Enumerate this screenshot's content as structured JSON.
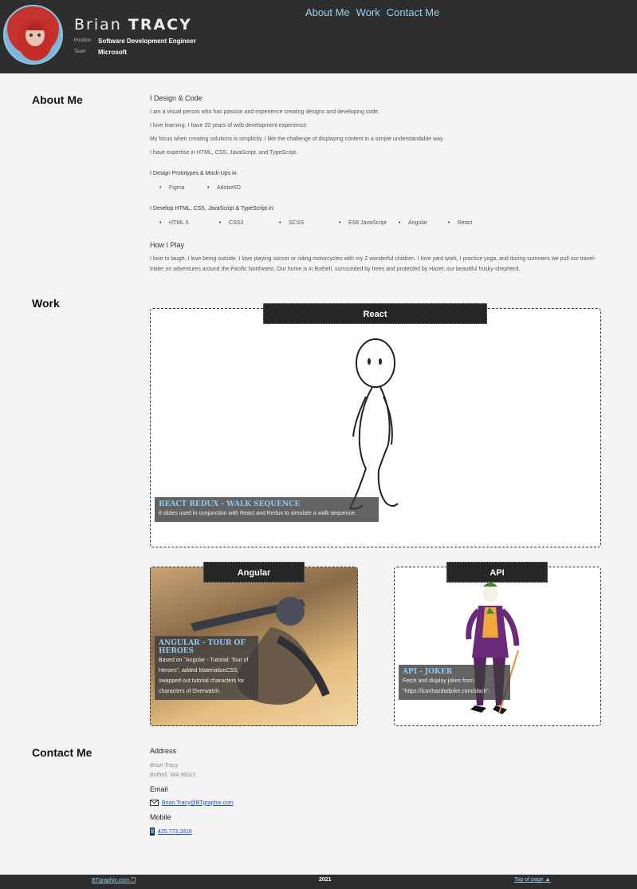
{
  "header": {
    "first_name": "Brian",
    "last_name": "TRACY",
    "position_label": "Position",
    "position_value": "Software Development Engineer",
    "team_label": "Team",
    "team_value": "Microsoft"
  },
  "nav": {
    "about": "About Me",
    "work": "Work",
    "contact": "Contact Me"
  },
  "about": {
    "title": "About Me",
    "design_heading": "I Design & Code",
    "lines": [
      "I am a visual person who has passion and experience creating designs and developing code.",
      "I love learning. I have 20 years of web development experience.",
      "My focus when creating solutions is simplicity. I like the challenge of displaying content in a simple understandable way.",
      "I have expertise in HTML, CSS, JavaScript, and TypeScript."
    ],
    "prototypes_heading": "I Design Prototypes & Mock-Ups in:",
    "prototype_tools": [
      "Figma",
      "AdobeXD"
    ],
    "develop_heading": "I Develop HTML, CSS, JavaScript & TypeScript in:",
    "develop_tools": [
      "HTML 5",
      "CSS3",
      "SCSS",
      "ES6 JavaScript",
      "Angular",
      "React"
    ],
    "play_heading": "How I Play",
    "play_text": "I love to laugh. I love being outside. I love playing soccer or riding motorcycles with my 2 wonderful children. I love yard work, I practice yoga, and during summers we pull our travel-trailer on adventures around the Pacific Northwest. Our home is in Bothell, surrounded by trees and protected by Hazel, our beautiful husky-shepherd."
  },
  "work": {
    "title": "Work",
    "react": {
      "label": "React",
      "caption_title": "REACT REDUX - WALK SEQUENCE",
      "caption_text": "8 slides used in conjunction with React and Redux to simulate a walk sequence."
    },
    "angular": {
      "label": "Angular",
      "caption_title": "ANGULAR - TOUR OF HEROES",
      "caption_text": "Based on \"Angular - Tutorial: Tour of Heroes\", added MaterializeCSS, swapped out tutorial characters for characters of Overwatch."
    },
    "api": {
      "label": "API",
      "caption_title": "API - JOKER",
      "caption_text": "Fetch and display jokes from \"https://icanhazdadjoke.com/slack\"."
    }
  },
  "contact": {
    "title": "Contact Me",
    "address_label": "Address",
    "address_line1": "Brian Tracy",
    "address_line2": "Bothell, WA 98021",
    "email_label": "Email",
    "email": "Brian.Tracy@BTgraphix.com",
    "mobile_label": "Mobile",
    "mobile": "425.773.2818"
  },
  "footer": {
    "site": "BTgraphix.com",
    "year": "2021",
    "top": "Top of page"
  },
  "colors": {
    "header_bg": "#2e2e2e",
    "nav_link": "#9fd0f2",
    "caption_title": "#8ec8f5"
  }
}
